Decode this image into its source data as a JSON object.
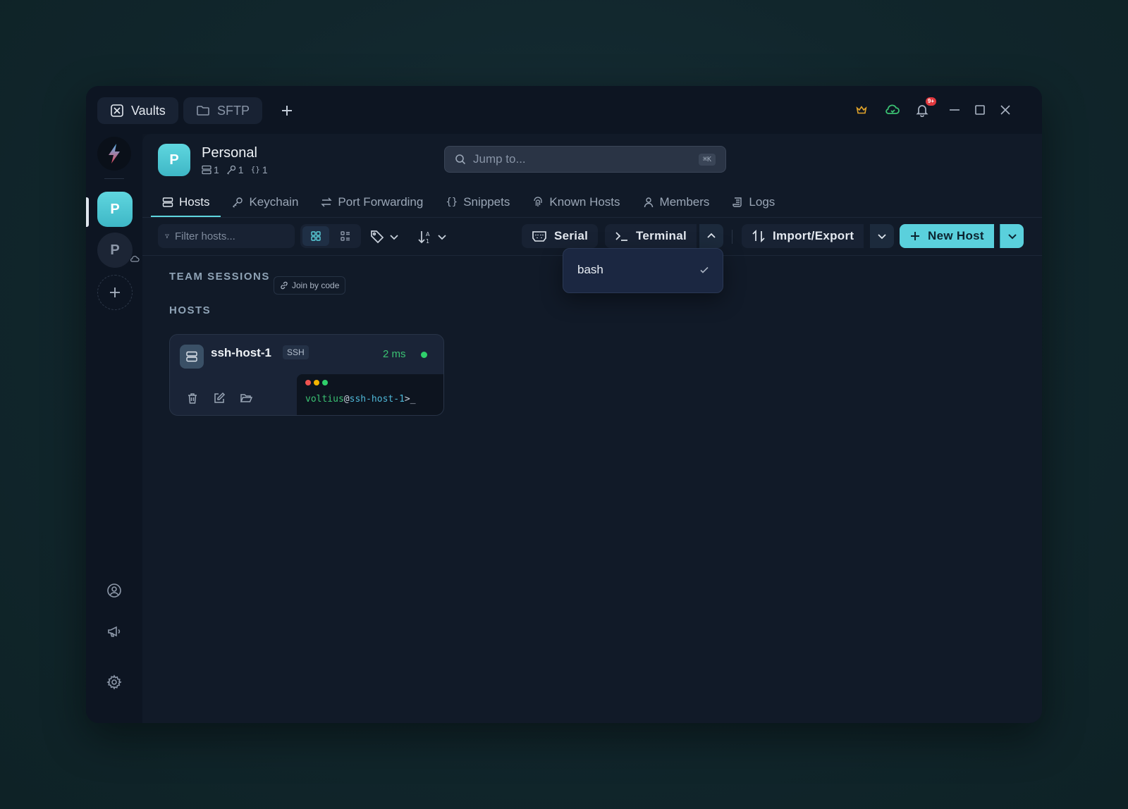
{
  "titlebar": {
    "tabs": [
      {
        "label": "Vaults",
        "icon": "vault-icon",
        "active": true
      },
      {
        "label": "SFTP",
        "icon": "folder-icon",
        "active": false
      }
    ],
    "notification_count": "9+"
  },
  "rail": {
    "vaults": [
      {
        "letter": "P",
        "active": true
      },
      {
        "letter": "P",
        "active": false
      }
    ]
  },
  "vault": {
    "avatar_letter": "P",
    "name": "Personal",
    "stats": {
      "hosts": "1",
      "keys": "1",
      "snippets": "1"
    }
  },
  "search": {
    "placeholder": "Jump to...",
    "shortcut": "⌘K"
  },
  "nav": {
    "tabs": [
      {
        "label": "Hosts",
        "icon": "server-icon",
        "active": true
      },
      {
        "label": "Keychain",
        "icon": "key-icon",
        "active": false
      },
      {
        "label": "Port Forwarding",
        "icon": "arrows-icon",
        "active": false
      },
      {
        "label": "Snippets",
        "icon": "braces-icon",
        "active": false
      },
      {
        "label": "Known Hosts",
        "icon": "fingerprint-icon",
        "active": false
      },
      {
        "label": "Members",
        "icon": "user-icon",
        "active": false
      },
      {
        "label": "Logs",
        "icon": "scroll-icon",
        "active": false
      }
    ]
  },
  "toolbar": {
    "filter_placeholder": "Filter hosts...",
    "serial_label": "Serial",
    "terminal_label": "Terminal",
    "import_export_label": "Import/Export",
    "new_host_label": "New Host"
  },
  "sections": {
    "team_sessions": "TEAM SESSIONS",
    "join_by_code": "Join by code",
    "hosts": "HOSTS"
  },
  "host": {
    "name": "ssh-host-1",
    "protocol": "SSH",
    "ping": "2 ms",
    "status_color": "#2fd06b",
    "terminal_user": "voltius",
    "terminal_at": "@",
    "terminal_host": "ssh-host-1",
    "terminal_prompt": ">_"
  },
  "dropdown": {
    "items": [
      {
        "label": "bash",
        "selected": true
      }
    ]
  },
  "colors": {
    "accent": "#5ad0dc",
    "status_green": "#2fd06b",
    "crown": "#e0a32a",
    "cloud": "#3bc273",
    "badge": "#e0383e"
  }
}
